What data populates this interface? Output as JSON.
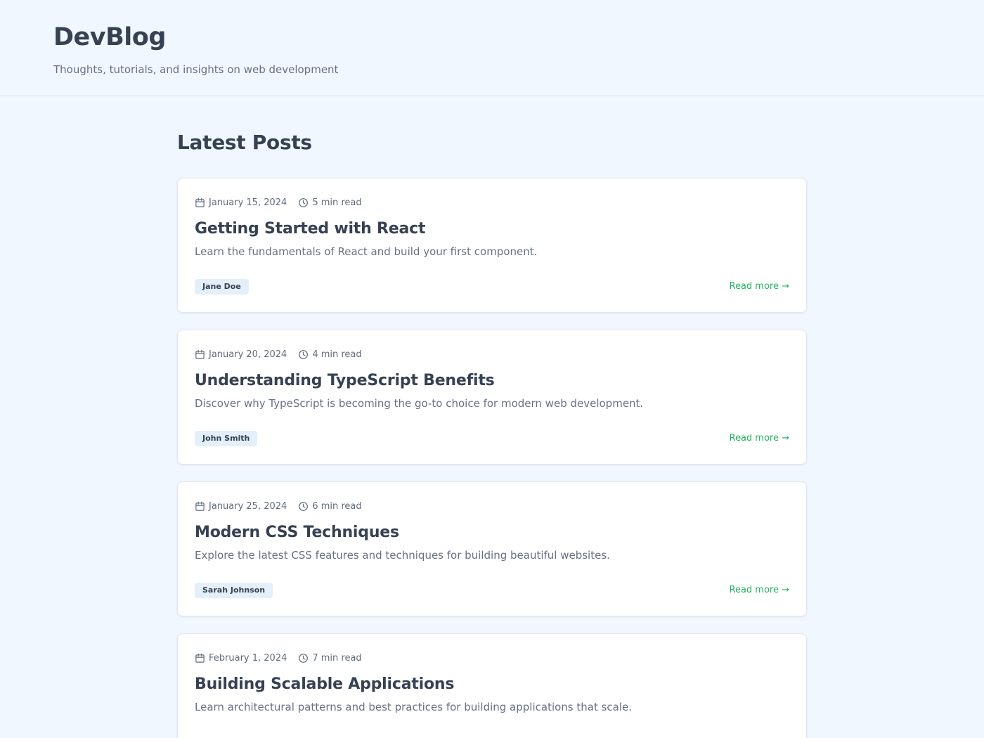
{
  "header": {
    "title": "DevBlog",
    "subtitle": "Thoughts, tutorials, and insights on web development"
  },
  "main": {
    "section_title": "Latest Posts",
    "posts": [
      {
        "date": "January 15, 2024",
        "read_time": "5 min read",
        "title": "Getting Started with React",
        "excerpt": "Learn the fundamentals of React and build your first component.",
        "author": "Jane Doe",
        "read_more": "Read more →"
      },
      {
        "date": "January 20, 2024",
        "read_time": "4 min read",
        "title": "Understanding TypeScript Benefits",
        "excerpt": "Discover why TypeScript is becoming the go-to choice for modern web development.",
        "author": "John Smith",
        "read_more": "Read more →"
      },
      {
        "date": "January 25, 2024",
        "read_time": "6 min read",
        "title": "Modern CSS Techniques",
        "excerpt": "Explore the latest CSS features and techniques for building beautiful websites.",
        "author": "Sarah Johnson",
        "read_more": "Read more →"
      },
      {
        "date": "February 1, 2024",
        "read_time": "7 min read",
        "title": "Building Scalable Applications",
        "excerpt": "Learn architectural patterns and best practices for building applications that scale.",
        "author": "",
        "read_more": ""
      }
    ]
  },
  "icons": {
    "date": "calendar-icon",
    "read_time": "clock-icon"
  },
  "colors": {
    "background": "#f0f7fe",
    "accent": "#22b35e",
    "badge_background": "#e3f0fb",
    "text_primary": "#364152",
    "text_secondary": "#667085"
  }
}
